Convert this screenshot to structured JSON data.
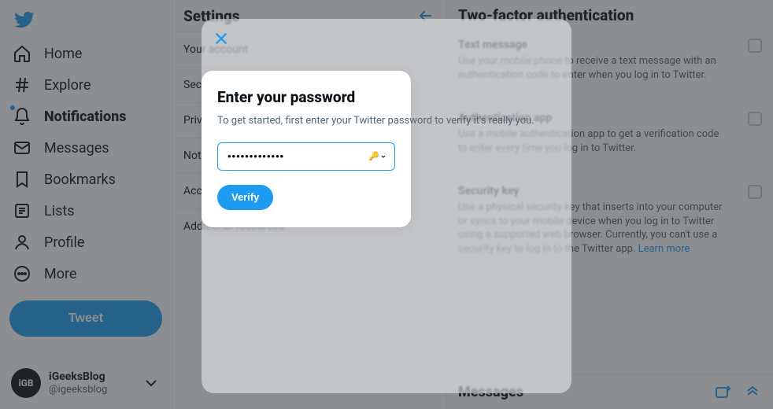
{
  "nav": {
    "items": [
      {
        "icon": "home",
        "label": "Home"
      },
      {
        "icon": "explore",
        "label": "Explore"
      },
      {
        "icon": "bell",
        "label": "Notifications",
        "bold": true,
        "dot": true
      },
      {
        "icon": "mail",
        "label": "Messages"
      },
      {
        "icon": "bookmark",
        "label": "Bookmarks"
      },
      {
        "icon": "list",
        "label": "Lists"
      },
      {
        "icon": "profile",
        "label": "Profile"
      },
      {
        "icon": "more",
        "label": "More"
      }
    ],
    "tweet": "Tweet",
    "account": {
      "avatar": "iGB",
      "name": "iGeeksBlog ",
      "handle": "@igeeksblog"
    }
  },
  "settings": {
    "title": "Settings",
    "rows": [
      "Your account",
      "Security and account access",
      "Privacy and safety",
      "Notifications",
      "Accessibility, display, and languages",
      "Additional resources"
    ]
  },
  "tfa": {
    "title": "Two-factor authentication",
    "items": [
      {
        "title": "Text message",
        "desc": "Use your mobile phone to receive a text message with an authentication code to enter when you log in to Twitter."
      },
      {
        "title": "Authentication app",
        "desc": "Use a mobile authentication app to get a verification code to enter every time you log in to Twitter."
      },
      {
        "title": "Security key",
        "desc": "Use a physical security key that inserts into your computer or syncs to your mobile device when you log in to Twitter using a supported web browser. Currently, you can't use a security key to log in to the Twitter app.",
        "learn_more": "Learn more"
      }
    ],
    "messages_bar": "Messages"
  },
  "modal": {
    "heading": "Enter your password",
    "body": "To get started, first enter your Twitter password to verify it's really you.",
    "value": "•••••••••••••",
    "verify": "Verify"
  }
}
